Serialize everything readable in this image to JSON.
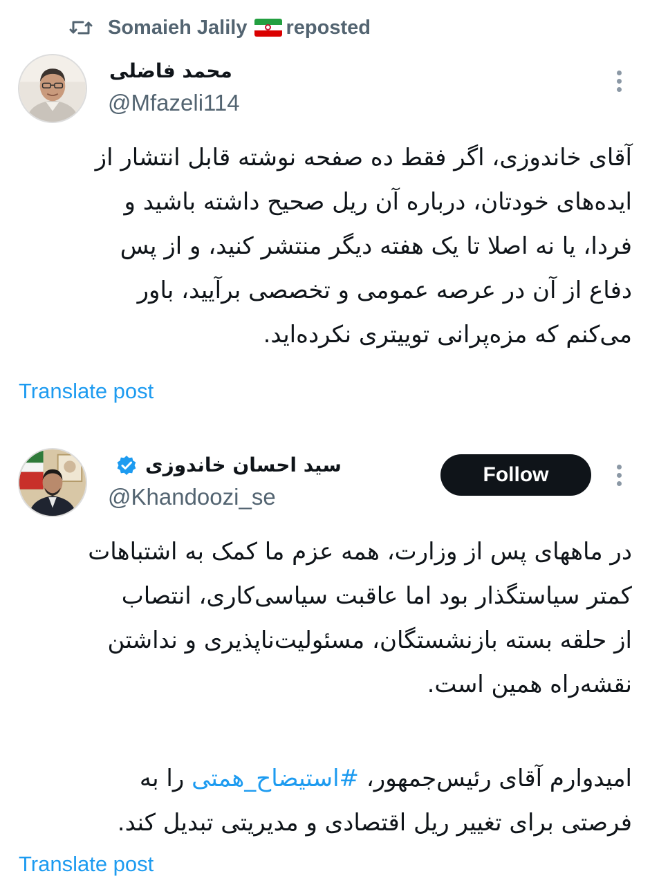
{
  "repost_header": {
    "reposter_name": "Somaieh Jalily",
    "flag_icon": "iran-flag-icon",
    "label": "reposted"
  },
  "posts": [
    {
      "author_name": "محمد فاضلی",
      "handle": "@Mfazeli114",
      "verified": false,
      "follow_button": null,
      "text_lines": [
        "آقای خاندوزی، اگر فقط ده صفحه نوشته قابل انتشار از",
        "ایده‌های خودتان، درباره آن ریل صحیح داشته باشید و",
        "فردا، یا نه اصلا تا یک هفته دیگر منتشر کنید، و از پس",
        "دفاع از آن در عرصه عمومی و تخصصی برآیید، باور",
        "می‌کنم که مزه‌پرانی توییتری نکرده‌اید."
      ],
      "translate_label": "Translate post"
    },
    {
      "author_name": "سید احسان خاندوزی",
      "handle": "@Khandoozi_se",
      "verified": true,
      "follow_button": "Follow",
      "text_lines": [
        "در ماههای پس از وزارت، همه عزم ما کمک به اشتباهات",
        "کمتر سیاستگذار بود اما عاقبت سیاسی‌کاری، انتصاب",
        "از حلقه بسته بازنشستگان، مسئولیت‌ناپذیری و نداشتن",
        "نقشه‌راه همین است."
      ],
      "text_lines_2_prefix": "امیدوارم آقای رئیس‌جمهور، ",
      "hashtag": "#استیضاح_همتی",
      "text_lines_2_suffix": " را به",
      "text_lines_2_last": "فرصتی برای تغییر ریل اقتصادی و مدیریتی تبدیل کند.",
      "translate_label": "Translate post"
    }
  ],
  "colors": {
    "text": "#0f1419",
    "secondary": "#536471",
    "link": "#1d9bf0",
    "follow_bg": "#0f1419",
    "verified": "#1d9bf0"
  }
}
